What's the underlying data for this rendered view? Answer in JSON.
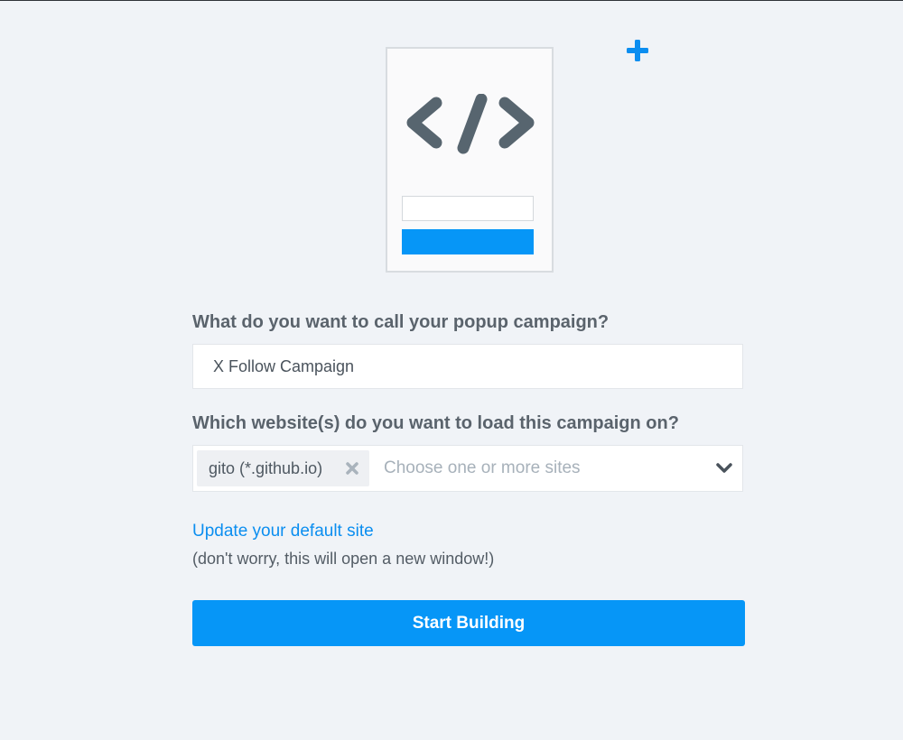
{
  "illustration": {
    "icon": "code-icon",
    "accent_color": "#0696f7"
  },
  "decoration": {
    "icon": "plus-icon",
    "color": "#0696f7"
  },
  "form": {
    "campaign_name_question": "What do you want to call your popup campaign?",
    "campaign_name_value": "X Follow Campaign",
    "sites_question": "Which website(s) do you want to load this campaign on?",
    "selected_sites": [
      {
        "label": "gito (*.github.io)"
      }
    ],
    "sites_placeholder": "Choose one or more sites",
    "update_site_link": "Update your default site",
    "update_site_note": "(don't worry, this will open a new window!)",
    "submit_label": "Start Building"
  },
  "colors": {
    "background": "#f0f3f7",
    "primary": "#0696f7",
    "link": "#0b8ef0"
  }
}
